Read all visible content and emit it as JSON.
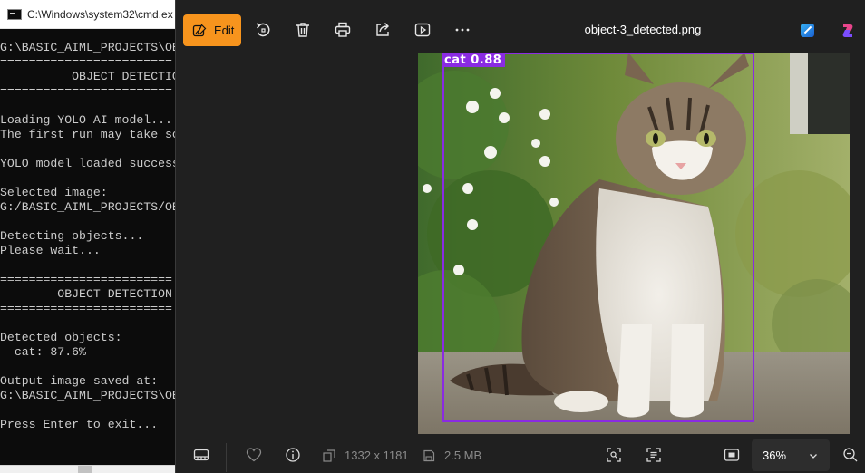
{
  "cmd": {
    "title": "C:\\Windows\\system32\\cmd.ex",
    "lines": [
      "G:\\BASIC_AIML_PROJECTS\\OB",
      "========================",
      "          OBJECT DETECTIO",
      "========================",
      "",
      "Loading YOLO AI model...",
      "The first run may take so",
      "",
      "YOLO model loaded success",
      "",
      "Selected image:",
      "G:/BASIC_AIML_PROJECTS/OB",
      "",
      "Detecting objects...",
      "Please wait...",
      "",
      "========================",
      "        OBJECT DETECTION",
      "========================",
      "",
      "Detected objects:",
      "  cat: 87.6%",
      "",
      "Output image saved at:",
      "G:\\BASIC_AIML_PROJECTS\\OB",
      "",
      "Press Enter to exit..."
    ]
  },
  "viewer": {
    "edit_label": "Edit",
    "file_name": "object-3_detected.png",
    "toolbar_icons": [
      "rotate-icon",
      "delete-icon",
      "print-icon",
      "share-icon",
      "slideshow-icon",
      "more-icon"
    ],
    "accent_color": "#f7941d"
  },
  "detection": {
    "label": "cat",
    "confidence": "0.88",
    "box_color": "#8a2be2"
  },
  "status": {
    "dimensions": "1332 x 1181",
    "file_size": "2.5 MB",
    "zoom": "36%"
  }
}
